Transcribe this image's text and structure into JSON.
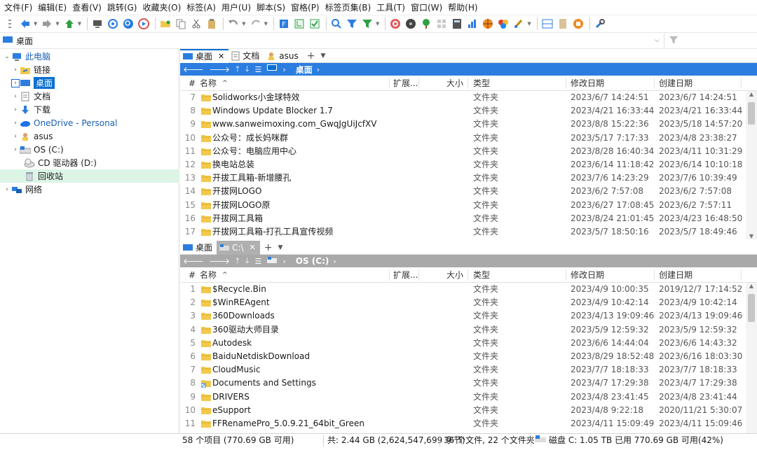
{
  "menu": [
    "文件(F)",
    "编辑(E)",
    "查看(V)",
    "跳转(G)",
    "收藏夹(O)",
    "标签(A)",
    "用户(U)",
    "脚本(S)",
    "窗格(P)",
    "标签页集(B)",
    "工具(T)",
    "窗口(W)",
    "帮助(H)"
  ],
  "address": {
    "path": "桌面"
  },
  "tree": [
    {
      "label": "此电脑",
      "blue": true
    },
    {
      "label": "链接"
    },
    {
      "label": "桌面",
      "selected": true
    },
    {
      "label": "文档"
    },
    {
      "label": "下载"
    },
    {
      "label": "OneDrive - Personal",
      "blue": true
    },
    {
      "label": "asus"
    },
    {
      "label": "OS (C:)"
    },
    {
      "label": "CD 驱动器 (D:)"
    },
    {
      "label": "回收站"
    },
    {
      "label": "网络"
    }
  ],
  "pane_top": {
    "tabs": [
      "桌面",
      "文档",
      "asus"
    ],
    "crumb": "桌面",
    "columns": {
      "num": "#",
      "name": "名称",
      "ext": "扩展...",
      "size": "大小",
      "type": "类型",
      "modified": "修改日期",
      "created": "创建日期"
    },
    "rows": [
      {
        "n": "7",
        "name": "Solidworks小金球特效",
        "type": "文件夹",
        "modified": "2023/6/7 14:24:51",
        "created": "2023/6/7 14:24:51"
      },
      {
        "n": "8",
        "name": "Windows Update Blocker 1.7",
        "type": "文件夹",
        "modified": "2023/4/21 16:33:44",
        "created": "2023/4/21 16:33:44"
      },
      {
        "n": "9",
        "name": "www.sanweimoxing.com_GwqJgUiJcfXV",
        "type": "文件夹",
        "modified": "2023/8/8 15:22:36",
        "created": "2023/5/18 14:57:20"
      },
      {
        "n": "10",
        "name": "公众号：成长妈咪群",
        "type": "文件夹",
        "modified": "2023/5/17 7:17:33",
        "created": "2023/4/8 23:38:27"
      },
      {
        "n": "11",
        "name": "公众号：电脑应用中心",
        "type": "文件夹",
        "modified": "2023/8/28 16:40:34",
        "created": "2023/4/11 10:31:29"
      },
      {
        "n": "12",
        "name": "换电站总装",
        "type": "文件夹",
        "modified": "2023/6/14 11:18:42",
        "created": "2023/6/14 10:10:18"
      },
      {
        "n": "13",
        "name": "开拔工具箱-新增腰孔",
        "type": "文件夹",
        "modified": "2023/7/6 14:23:29",
        "created": "2023/7/6 10:39:49"
      },
      {
        "n": "14",
        "name": "开拔网LOGO",
        "type": "文件夹",
        "modified": "2023/6/2 7:57:08",
        "created": "2023/6/2 7:57:08"
      },
      {
        "n": "15",
        "name": "开拔网LOGO原",
        "type": "文件夹",
        "modified": "2023/6/27 17:08:45",
        "created": "2023/6/2 7:57:11"
      },
      {
        "n": "16",
        "name": "开拔网工具箱",
        "type": "文件夹",
        "modified": "2023/8/24 21:01:45",
        "created": "2023/4/23 16:48:50"
      },
      {
        "n": "17",
        "name": "开拔网工具箱-打孔工具宣传视频",
        "type": "文件夹",
        "modified": "2023/5/7 18:50:16",
        "created": "2023/5/7 18:49:46"
      }
    ]
  },
  "pane_bottom": {
    "tabs": [
      "桌面",
      "C:\\"
    ],
    "crumb": "OS (C:)",
    "columns": {
      "num": "#",
      "name": "名称",
      "ext": "扩展...",
      "size": "大小",
      "type": "类型",
      "modified": "修改日期",
      "created": "创建日期"
    },
    "rows": [
      {
        "n": "1",
        "name": "$Recycle.Bin",
        "type": "文件夹",
        "modified": "2023/4/9 10:00:35",
        "created": "2019/12/7 17:14:52"
      },
      {
        "n": "2",
        "name": "$WinREAgent",
        "type": "文件夹",
        "modified": "2023/4/9 10:42:14",
        "created": "2023/4/9 10:42:14"
      },
      {
        "n": "3",
        "name": "360Downloads",
        "type": "文件夹",
        "modified": "2023/4/13 19:09:46",
        "created": "2023/4/13 19:09:46"
      },
      {
        "n": "4",
        "name": "360驱动大师目录",
        "type": "文件夹",
        "modified": "2023/5/9 12:59:32",
        "created": "2023/5/9 12:59:32"
      },
      {
        "n": "5",
        "name": "Autodesk",
        "type": "文件夹",
        "modified": "2023/6/6 14:44:04",
        "created": "2023/6/6 14:43:32"
      },
      {
        "n": "6",
        "name": "BaiduNetdiskDownload",
        "type": "文件夹",
        "modified": "2023/8/29 18:52:48",
        "created": "2023/6/16 18:03:30"
      },
      {
        "n": "7",
        "name": "CloudMusic",
        "type": "文件夹",
        "modified": "2023/7/7 18:18:33",
        "created": "2023/7/7 18:18:33"
      },
      {
        "n": "8",
        "name": "Documents and Settings",
        "type": "文件夹",
        "modified": "2023/4/7 17:29:38",
        "created": "2023/4/7 17:29:38"
      },
      {
        "n": "9",
        "name": "DRIVERS",
        "type": "文件夹",
        "modified": "2023/4/8 23:41:45",
        "created": "2023/4/8 23:41:44"
      },
      {
        "n": "10",
        "name": "eSupport",
        "type": "文件夹",
        "modified": "2023/4/8 9:22:18",
        "created": "2020/11/21 5:30:07"
      },
      {
        "n": "11",
        "name": "FFRenamePro_5.0.9.21_64bit_Green",
        "type": "文件夹",
        "modified": "2023/4/11 15:09:49",
        "created": "2023/4/11 15:09:46"
      }
    ]
  },
  "status": {
    "items": "58 个项目 (770.69 GB 可用)",
    "total": "共: 2.44 GB (2,624,547,699 字节)",
    "counts": "36 个文件, 22 个文件夹",
    "disk": "磁盘 C: 1.05 TB 已用  770.69 GB 可用(42%)"
  },
  "colors": {
    "accent": "#0b6fd1",
    "nav_blue": "#2b7de0",
    "nav_gray": "#a9a9a9",
    "folder": "#f2c94c",
    "recycle_bg": "#dcf5e6"
  }
}
